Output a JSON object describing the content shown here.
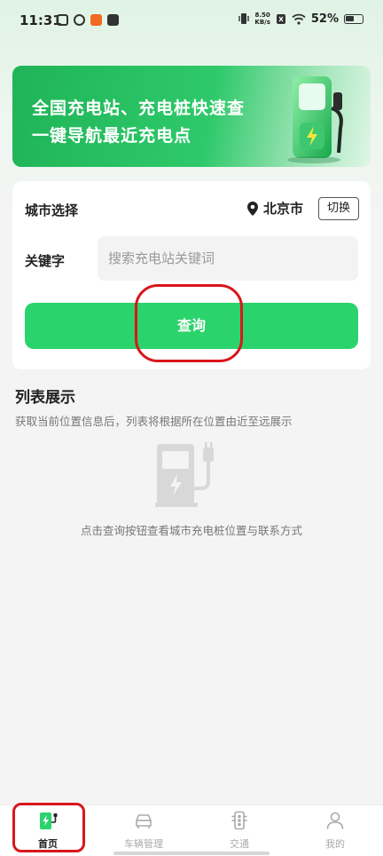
{
  "status_bar": {
    "time": "11:31",
    "net_speed_value": "8.50",
    "net_speed_unit": "KB/s",
    "battery_pct": "52%"
  },
  "banner": {
    "line1": "全国充电站、充电桩快速查",
    "line2": "一键导航最近充电点"
  },
  "form": {
    "city_label": "城市选择",
    "city_value": "北京市",
    "switch_label": "切换",
    "keyword_label": "关键字",
    "keyword_placeholder": "搜索充电站关键词",
    "keyword_value": "",
    "query_label": "查询"
  },
  "list": {
    "title": "列表展示",
    "description": "获取当前位置信息后，列表将根据所在位置由近至远展示",
    "empty_text": "点击查询按钮查看城市充电桩位置与联系方式"
  },
  "tabs": [
    {
      "label": "首页",
      "icon": "charging-station-icon",
      "active": true
    },
    {
      "label": "车辆管理",
      "icon": "car-icon",
      "active": false
    },
    {
      "label": "交通",
      "icon": "traffic-light-icon",
      "active": false
    },
    {
      "label": "我的",
      "icon": "user-icon",
      "active": false
    }
  ],
  "colors": {
    "accent": "#2bd36d",
    "banner": "#1fb457",
    "annotation": "#d9161c"
  }
}
